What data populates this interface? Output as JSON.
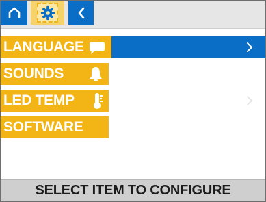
{
  "toolbar": {
    "home_icon": "home-icon",
    "settings_icon": "gear-icon",
    "back_icon": "chevron-left-icon"
  },
  "menu": {
    "items": [
      {
        "label": "LANGUAGE",
        "icon": "speech-bubble-icon",
        "selected": true,
        "chevron": true
      },
      {
        "label": "SOUNDS",
        "icon": "bell-icon",
        "selected": false,
        "chevron": false
      },
      {
        "label": "LED TEMP",
        "icon": "thermometer-icon",
        "selected": false,
        "chevron": true
      },
      {
        "label": "SOFTWARE",
        "icon": "",
        "selected": false,
        "chevron": false
      }
    ]
  },
  "status": {
    "text": "SELECT ITEM TO CONFIGURE"
  },
  "colors": {
    "accent_blue": "#0a6ec6",
    "label_yellow": "#f3b516",
    "status_bar": "#cfcfcf"
  }
}
